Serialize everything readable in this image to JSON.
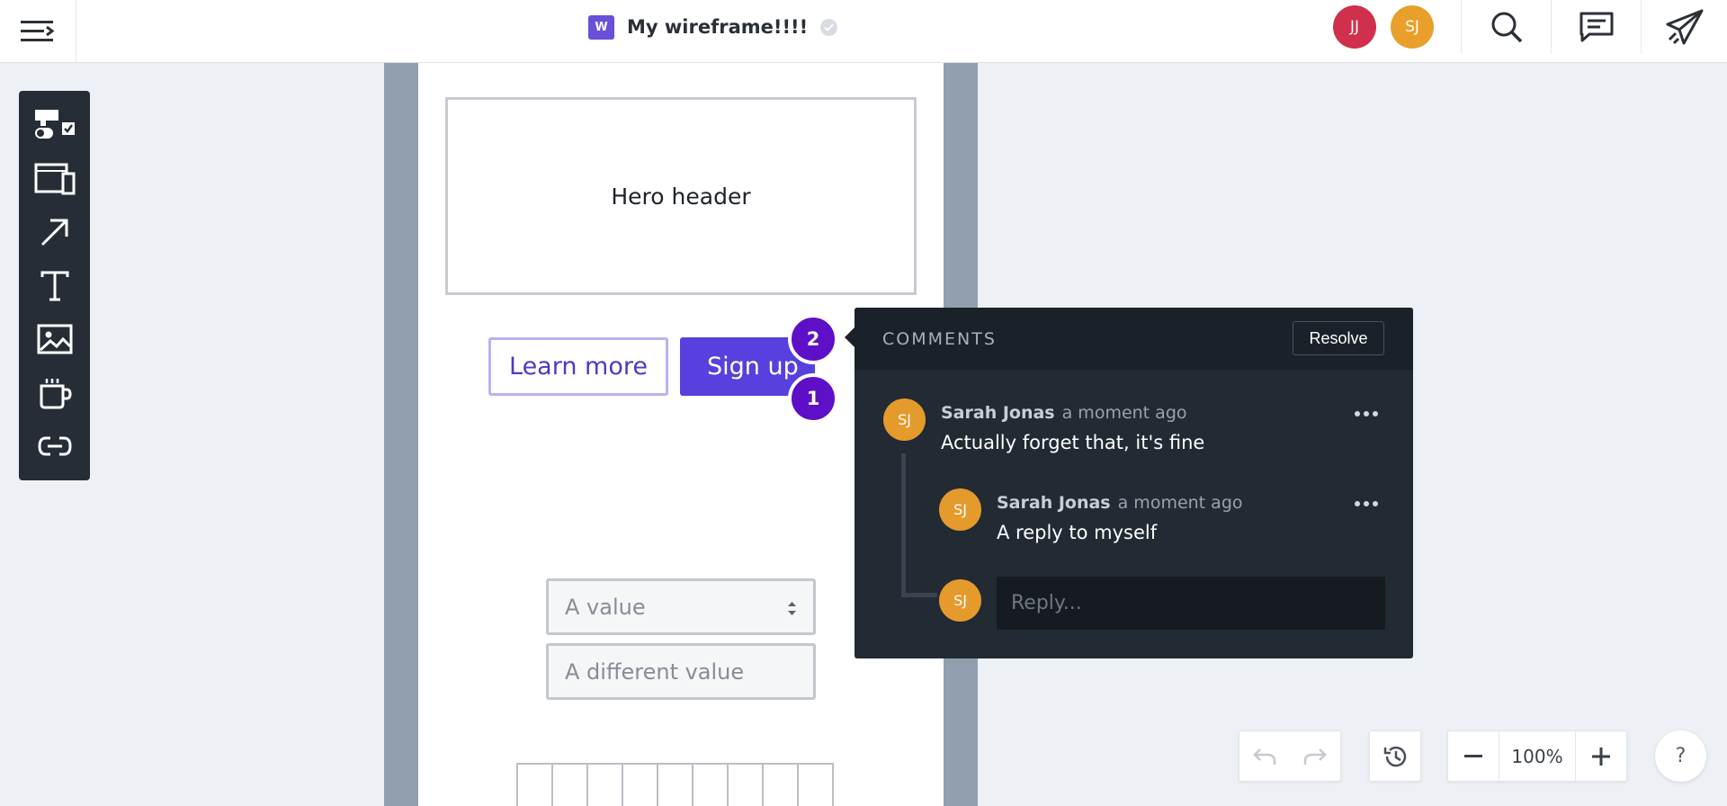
{
  "topbar": {
    "doc_badge": "W",
    "doc_title": "My wireframe!!!!",
    "avatars": [
      {
        "initials": "JJ",
        "color": "#d0304b"
      },
      {
        "initials": "SJ",
        "color": "#e8a02a"
      }
    ]
  },
  "toolbar": {
    "tools": [
      "components-icon",
      "device-frames-icon",
      "arrow-icon",
      "text-icon",
      "image-icon",
      "cup-icon",
      "link-icon"
    ]
  },
  "canvas": {
    "hero_label": "Hero header",
    "learn_more_label": "Learn more",
    "sign_up_label": "Sign up",
    "pins": [
      "2",
      "1"
    ],
    "select_value": "A value",
    "input_value": "A different value"
  },
  "comments": {
    "title": "COMMENTS",
    "resolve_label": "Resolve",
    "thread": [
      {
        "initials": "SJ",
        "author": "Sarah Jonas",
        "time": "a moment ago",
        "body": "Actually forget that, it's fine"
      },
      {
        "initials": "SJ",
        "author": "Sarah Jonas",
        "time": "a moment ago",
        "body": "A reply to myself"
      }
    ],
    "reply_initials": "SJ",
    "reply_placeholder": "Reply..."
  },
  "controls": {
    "zoom": "100%",
    "help": "?"
  },
  "colors": {
    "accent": "#5740dd",
    "pin": "#5d10c7",
    "panel": "#222a33"
  }
}
